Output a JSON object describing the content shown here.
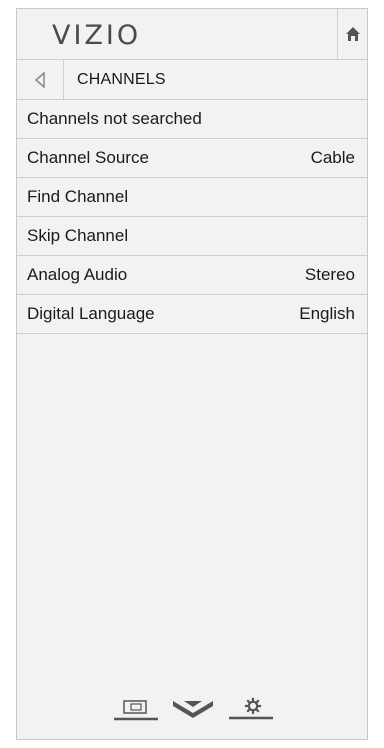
{
  "header": {
    "brand": "VIZIO",
    "home_icon": "home-icon"
  },
  "breadcrumb": {
    "back_icon": "back-arrow-icon",
    "label": "CHANNELS"
  },
  "menu": {
    "items": [
      {
        "label": "Channels not searched",
        "value": ""
      },
      {
        "label": "Channel Source",
        "value": "Cable"
      },
      {
        "label": "Find Channel",
        "value": ""
      },
      {
        "label": "Skip Channel",
        "value": ""
      },
      {
        "label": "Analog Audio",
        "value": "Stereo"
      },
      {
        "label": "Digital Language",
        "value": "English"
      }
    ]
  },
  "bottom_nav": {
    "items": [
      {
        "icon": "input-display-icon"
      },
      {
        "icon": "vizio-v-icon"
      },
      {
        "icon": "settings-gear-icon"
      }
    ]
  },
  "colors": {
    "panel_bg": "#f2f2f2",
    "divider": "#cfcfcf",
    "text": "#1a1a1a",
    "icon": "#555555"
  }
}
